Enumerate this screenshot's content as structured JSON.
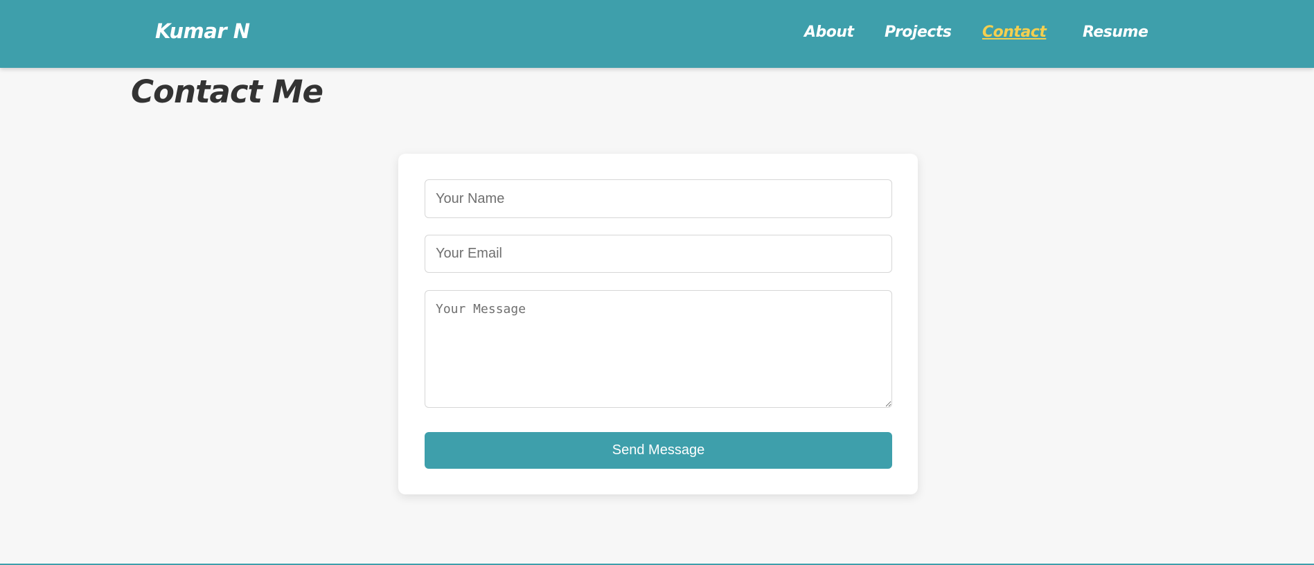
{
  "header": {
    "brand": "Kumar N",
    "nav": [
      {
        "label": "About",
        "active": false
      },
      {
        "label": "Projects",
        "active": false
      },
      {
        "label": "Contact",
        "active": true
      },
      {
        "label": "Resume",
        "active": false
      }
    ]
  },
  "main": {
    "title": "Contact Me"
  },
  "form": {
    "name_placeholder": "Your Name",
    "email_placeholder": "Your Email",
    "message_placeholder": "Your Message",
    "submit_label": "Send Message"
  },
  "colors": {
    "primary": "#3e9fab",
    "active_nav": "#f4cf4f",
    "background": "#f7f7f7",
    "heading": "#333333"
  }
}
